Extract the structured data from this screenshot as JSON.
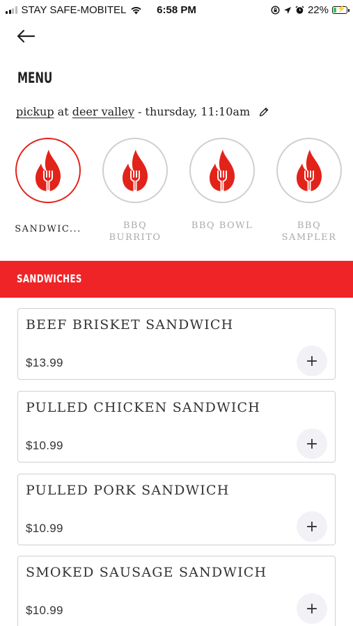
{
  "status_bar": {
    "carrier": "STAY SAFE-MOBITEL",
    "time": "6:58 PM",
    "battery": "22%",
    "battery_level": 0.22,
    "icons": [
      "signal-icon",
      "wifi-icon",
      "screen-lock-icon",
      "location-icon",
      "alarm-icon",
      "battery-icon"
    ]
  },
  "header": {
    "back_icon": "arrow-left-icon",
    "title": "MENU"
  },
  "order_info": {
    "mode": "pickup",
    "connector": "at",
    "location": "deer valley",
    "time_text": "- thursday, 11:10am",
    "edit_icon": "pencil-icon"
  },
  "categories": [
    {
      "label": "SANDWIC...",
      "icon": "flame-fork-icon",
      "selected": true
    },
    {
      "label": "BBQ BURRITO",
      "icon": "flame-fork-icon",
      "selected": false
    },
    {
      "label": "BBQ BOWL",
      "icon": "flame-fork-icon",
      "selected": false
    },
    {
      "label": "BBQ SAMPLER",
      "icon": "flame-fork-icon",
      "selected": false
    }
  ],
  "section": {
    "title": "SANDWICHES"
  },
  "items": [
    {
      "name": "BEEF BRISKET SANDWICH",
      "price": "$13.99",
      "add_label": "+"
    },
    {
      "name": "PULLED CHICKEN SANDWICH",
      "price": "$10.99",
      "add_label": "+"
    },
    {
      "name": "PULLED PORK SANDWICH",
      "price": "$10.99",
      "add_label": "+"
    },
    {
      "name": "SMOKED SAUSAGE SANDWICH",
      "price": "$10.99",
      "add_label": "+"
    }
  ],
  "colors": {
    "brand_red": "#ee2427",
    "flame_red": "#e2231a",
    "inactive_border": "#cfcfcf",
    "add_button_bg": "#f2f1f6"
  }
}
